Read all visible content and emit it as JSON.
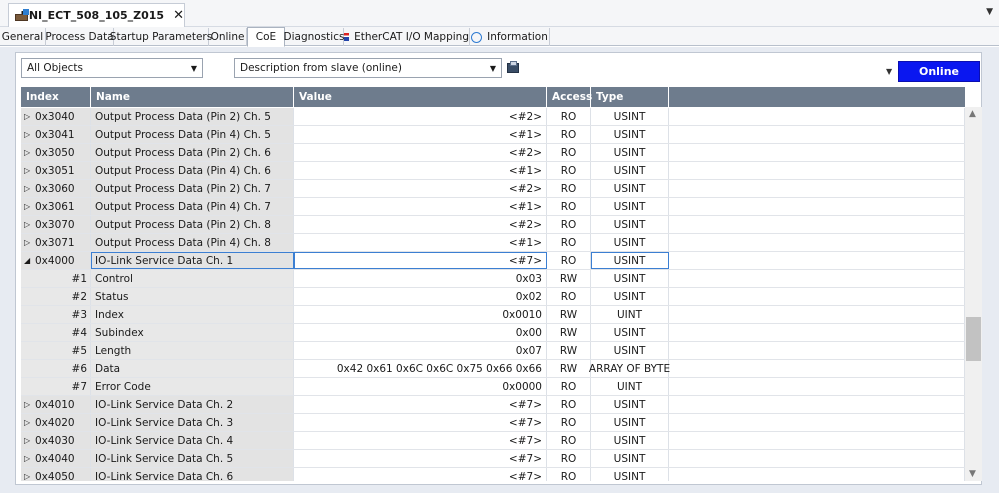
{
  "document": {
    "tab_title": "BNI_ECT_508_105_Z015",
    "close_glyph": "✕",
    "icon": "device-icon"
  },
  "editor_tabs": [
    {
      "label": "General"
    },
    {
      "label": "Process Data"
    },
    {
      "label": "Startup Parameters"
    },
    {
      "label": "Online"
    },
    {
      "label": "CoE",
      "active": true
    },
    {
      "label": "Diagnostics"
    },
    {
      "label": "EtherCAT I/O Mapping",
      "icon": "ethercat-flag-icon"
    },
    {
      "label": "Information",
      "icon": "info-circle-icon"
    }
  ],
  "toolbar": {
    "object_filter": "All Objects",
    "description_filter": "Description from slave (online)",
    "online_button": "Online"
  },
  "columns": {
    "index": "Index",
    "name": "Name",
    "value": "Value",
    "access": "Access",
    "type": "Type"
  },
  "rows": [
    {
      "index": "0x3040",
      "name": "Output Process Data (Pin 2) Ch. 5",
      "value": "<#2>",
      "access": "RO",
      "type": "USINT"
    },
    {
      "index": "0x3041",
      "name": "Output Process Data (Pin 4) Ch. 5",
      "value": "<#1>",
      "access": "RO",
      "type": "USINT"
    },
    {
      "index": "0x3050",
      "name": "Output Process Data (Pin 2) Ch. 6",
      "value": "<#2>",
      "access": "RO",
      "type": "USINT"
    },
    {
      "index": "0x3051",
      "name": "Output Process Data (Pin 4) Ch. 6",
      "value": "<#1>",
      "access": "RO",
      "type": "USINT"
    },
    {
      "index": "0x3060",
      "name": "Output Process Data (Pin 2) Ch. 7",
      "value": "<#2>",
      "access": "RO",
      "type": "USINT"
    },
    {
      "index": "0x3061",
      "name": "Output Process Data (Pin 4) Ch. 7",
      "value": "<#1>",
      "access": "RO",
      "type": "USINT"
    },
    {
      "index": "0x3070",
      "name": "Output Process Data (Pin 2) Ch. 8",
      "value": "<#2>",
      "access": "RO",
      "type": "USINT"
    },
    {
      "index": "0x3071",
      "name": "Output Process Data (Pin 4) Ch. 8",
      "value": "<#1>",
      "access": "RO",
      "type": "USINT"
    },
    {
      "index": "0x4000",
      "name": "IO-Link Service Data Ch. 1",
      "value": "<#7>",
      "access": "RO",
      "type": "USINT",
      "expanded": true,
      "selected": true
    },
    {
      "index": "#1",
      "name": "Control",
      "value": "0x03",
      "access": "RW",
      "type": "USINT",
      "sub": true
    },
    {
      "index": "#2",
      "name": "Status",
      "value": "0x02",
      "access": "RO",
      "type": "USINT",
      "sub": true
    },
    {
      "index": "#3",
      "name": "Index",
      "value": "0x0010",
      "access": "RW",
      "type": "UINT",
      "sub": true
    },
    {
      "index": "#4",
      "name": "Subindex",
      "value": "0x00",
      "access": "RW",
      "type": "USINT",
      "sub": true
    },
    {
      "index": "#5",
      "name": "Length",
      "value": "0x07",
      "access": "RW",
      "type": "USINT",
      "sub": true
    },
    {
      "index": "#6",
      "name": "Data",
      "value": "0x42 0x61 0x6C 0x6C 0x75 0x66 0x66",
      "access": "RW",
      "type": "ARRAY OF BYTE",
      "sub": true
    },
    {
      "index": "#7",
      "name": "Error Code",
      "value": "0x0000",
      "access": "RO",
      "type": "UINT",
      "sub": true
    },
    {
      "index": "0x4010",
      "name": "IO-Link Service Data Ch. 2",
      "value": "<#7>",
      "access": "RO",
      "type": "USINT"
    },
    {
      "index": "0x4020",
      "name": "IO-Link Service Data Ch. 3",
      "value": "<#7>",
      "access": "RO",
      "type": "USINT"
    },
    {
      "index": "0x4030",
      "name": "IO-Link Service Data Ch. 4",
      "value": "<#7>",
      "access": "RO",
      "type": "USINT"
    },
    {
      "index": "0x4040",
      "name": "IO-Link Service Data Ch. 5",
      "value": "<#7>",
      "access": "RO",
      "type": "USINT"
    },
    {
      "index": "0x4050",
      "name": "IO-Link Service Data Ch. 6",
      "value": "<#7>",
      "access": "RO",
      "type": "USINT"
    }
  ],
  "colors": {
    "header_bg": "#6e7c8d",
    "online_button": "#0a17f0",
    "selection": "#3c7fd2"
  }
}
